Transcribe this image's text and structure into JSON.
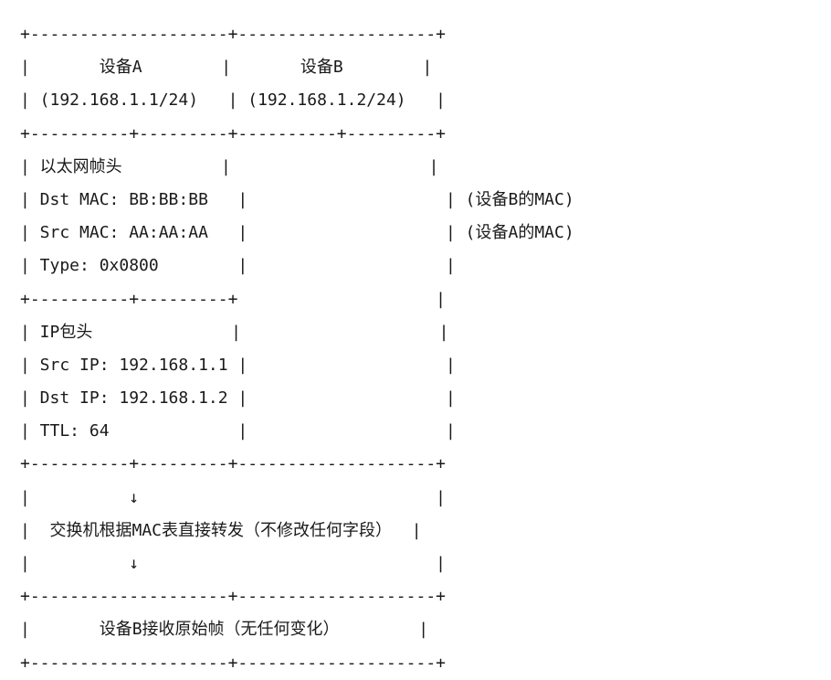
{
  "lines": [
    "+--------------------+--------------------+",
    "|       设备A        |       设备B        |",
    "| (192.168.1.1/24)   | (192.168.1.2/24)   |",
    "+----------+---------+----------+---------+",
    "| 以太网帧头          |                    |",
    "| Dst MAC: BB:BB:BB   |                    | (设备B的MAC)",
    "| Src MAC: AA:AA:AA   |                    | (设备A的MAC)",
    "| Type: 0x0800        |                    |",
    "+----------+---------+                    |",
    "| IP包头              |                    |",
    "| Src IP: 192.168.1.1 |                    |",
    "| Dst IP: 192.168.1.2 |                    |",
    "| TTL: 64             |                    |",
    "+----------+---------+--------------------+",
    "|          ↓                              |",
    "|  交换机根据MAC表直接转发（不修改任何字段）  |",
    "|          ↓                              |",
    "+--------------------+--------------------+",
    "|       设备B接收原始帧（无任何变化）        |",
    "+--------------------+--------------------+"
  ]
}
